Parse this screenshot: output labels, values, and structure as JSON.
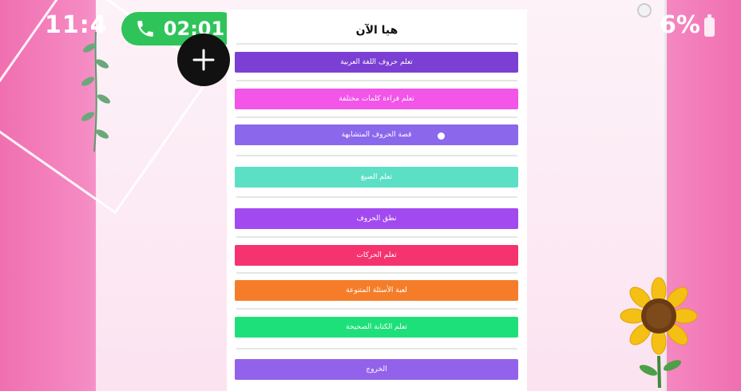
{
  "status_bar": {
    "time": "11:4",
    "call_duration": "02:01",
    "battery_text": "6%"
  },
  "page": {
    "title": "هيا الآن"
  },
  "menu_buttons": [
    {
      "label": "تعلم حروف اللغة العربية",
      "color": "#7b3fd4"
    },
    {
      "label": "تعلم قراءة كلمات مختلفة",
      "color": "#f255e8"
    },
    {
      "label": "قصة الحروف المتشابهة",
      "color": "#8b67ec"
    },
    {
      "label": "تعلم الصيغ",
      "color": "#5ce0c5"
    },
    {
      "label": "نطق الحروف",
      "color": "#a24af0"
    },
    {
      "label": "تعلم الحركات",
      "color": "#f5336e"
    },
    {
      "label": "لعبة الأسئلة المتنوعة",
      "color": "#f57d2a"
    },
    {
      "label": "تعلم الكتابة الصحيحة",
      "color": "#1ee07a"
    },
    {
      "label": "الخروج",
      "color": "#9263ea"
    }
  ],
  "icons": {
    "call": "phone-icon",
    "add": "plus-icon",
    "battery": "battery-icon"
  },
  "colors": {
    "call_pill": "#2fc45a",
    "plus_button": "#111111"
  }
}
